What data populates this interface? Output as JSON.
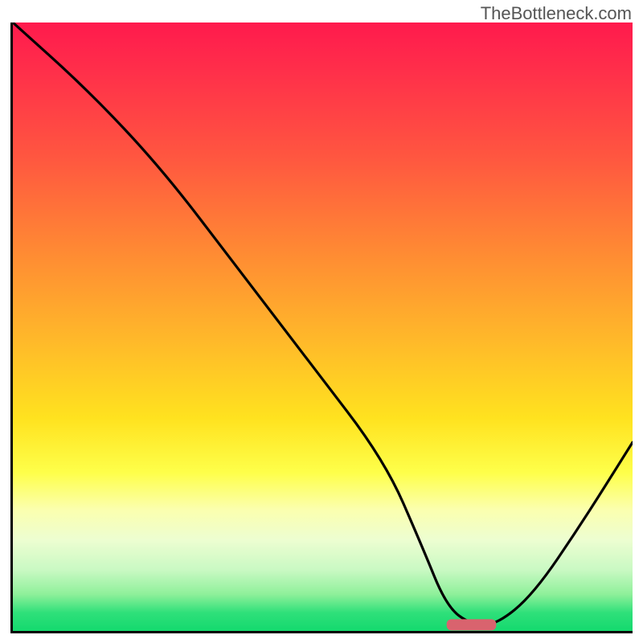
{
  "watermark": "TheBottleneck.com",
  "chart_data": {
    "type": "line",
    "title": "",
    "xlabel": "",
    "ylabel": "",
    "xlim": [
      0,
      100
    ],
    "ylim": [
      0,
      100
    ],
    "grid": false,
    "legend": false,
    "line": {
      "x": [
        0,
        12,
        24,
        36,
        48,
        60,
        66,
        70,
        74,
        78,
        84,
        92,
        100
      ],
      "y": [
        100,
        89,
        76,
        60,
        44,
        28,
        14,
        4,
        1,
        1,
        6,
        18,
        31
      ]
    },
    "marker": {
      "x_start": 70,
      "x_end": 78,
      "y": 1,
      "color": "#d9636e"
    },
    "background": {
      "type": "vertical-gradient",
      "stops": [
        {
          "pos": 0.0,
          "color": "#ff1a4d"
        },
        {
          "pos": 0.22,
          "color": "#ff5640"
        },
        {
          "pos": 0.52,
          "color": "#ffb82a"
        },
        {
          "pos": 0.74,
          "color": "#feff4a"
        },
        {
          "pos": 0.9,
          "color": "#c9f9c3"
        },
        {
          "pos": 1.0,
          "color": "#14d96e"
        }
      ]
    }
  }
}
